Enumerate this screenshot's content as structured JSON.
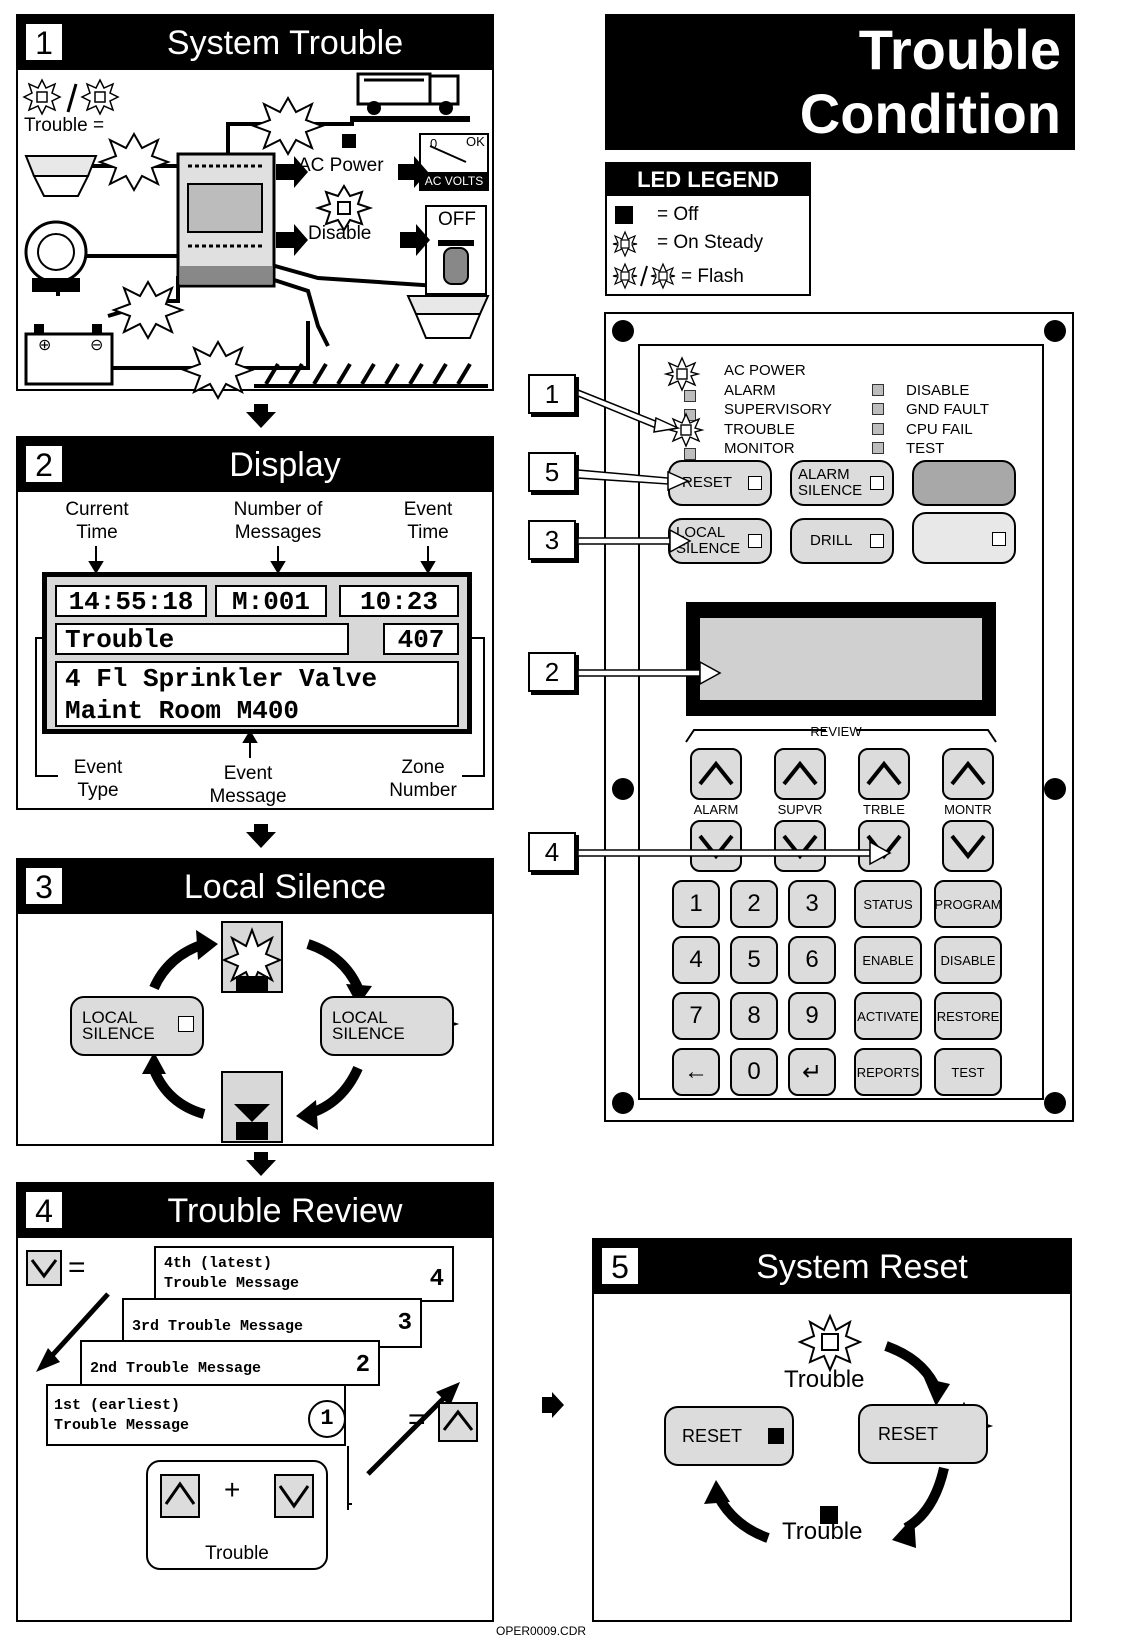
{
  "title": {
    "line1": "Trouble",
    "line2": "Condition"
  },
  "led_legend": {
    "title": "LED LEGEND",
    "items": [
      {
        "icon": "off-square-icon",
        "text": "= Off"
      },
      {
        "icon": "led-burst-icon",
        "text": "= On Steady"
      },
      {
        "icon": "led-flash-icon",
        "text": "= Flash"
      }
    ]
  },
  "panel1": {
    "num": "1",
    "title": "System Trouble",
    "trouble_label": "Trouble =",
    "ac_power": "AC Power",
    "disable": "Disable",
    "off": "OFF",
    "ac_volts": "AC VOLTS",
    "gauge_zero": "0",
    "gauge_ok": "OK"
  },
  "panel2": {
    "num": "2",
    "title": "Display",
    "top_labels": [
      "Current\nTime",
      "Number of\nMessages",
      "Event\nTime"
    ],
    "lcd": {
      "time": "14:55:18",
      "msgs": "M:001",
      "event_time": "10:23",
      "type": "Trouble",
      "zone": "407",
      "line3": "4 Fl Sprinkler Valve",
      "line4": "Maint Room M400"
    },
    "bottom_labels": [
      "Event\nType",
      "Event\nMessage",
      "Zone\nNumber"
    ]
  },
  "panel3": {
    "num": "3",
    "title": "Local Silence",
    "btn": "LOCAL\nSILENCE"
  },
  "panel4": {
    "num": "4",
    "title": "Trouble Review",
    "messages": [
      {
        "text": "4th (latest)\nTrouble Message",
        "num": "4"
      },
      {
        "text": "3rd Trouble Message",
        "num": "3"
      },
      {
        "text": "2nd Trouble Message",
        "num": "2"
      },
      {
        "text": "1st (earliest)\nTrouble Message",
        "num": "1"
      }
    ],
    "combo_label": "Trouble",
    "plus": "+",
    "equals": "="
  },
  "panel5": {
    "num": "5",
    "title": "System Reset",
    "trouble_top": "Trouble",
    "trouble_bottom": "Trouble",
    "reset": "RESET"
  },
  "control_panel": {
    "leds_left": [
      "AC POWER",
      "ALARM",
      "SUPERVISORY",
      "TROUBLE",
      "MONITOR"
    ],
    "leds_right": [
      "DISABLE",
      "GND FAULT",
      "CPU FAIL",
      "TEST"
    ],
    "buttons": [
      "RESET",
      "ALARM\nSILENCE",
      "LOCAL\nSILENCE",
      "DRILL"
    ],
    "review_label": "REVIEW",
    "review_keys": [
      "ALARM",
      "SUPVR",
      "TRBLE",
      "MONTR"
    ],
    "numpad": [
      "1",
      "2",
      "3",
      "4",
      "5",
      "6",
      "7",
      "8",
      "9",
      "←",
      "0",
      "↵"
    ],
    "function_keys": [
      "STATUS",
      "PROGRAM",
      "ENABLE",
      "DISABLE",
      "ACTIVATE",
      "RESTORE",
      "REPORTS",
      "TEST"
    ],
    "callouts": [
      "1",
      "5",
      "3",
      "2",
      "4"
    ]
  },
  "footer": "OPER0009.CDR"
}
